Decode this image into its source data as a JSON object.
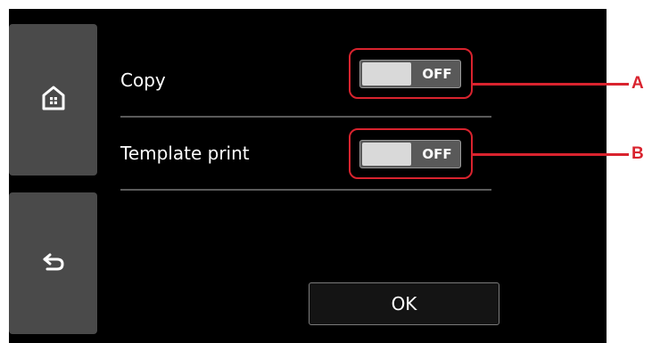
{
  "sidebar": {
    "home_icon": "home-icon",
    "back_icon": "back-arrow-icon"
  },
  "settings": {
    "rows": [
      {
        "label": "Copy",
        "toggle_state": "OFF",
        "callout": "A"
      },
      {
        "label": "Template print",
        "toggle_state": "OFF",
        "callout": "B"
      }
    ]
  },
  "ok_label": "OK",
  "colors": {
    "screen_bg": "#000000",
    "button_bg": "#4a4a4a",
    "callout": "#d9232e",
    "toggle_knob": "#d9d9d9",
    "toggle_bg": "#595959"
  }
}
